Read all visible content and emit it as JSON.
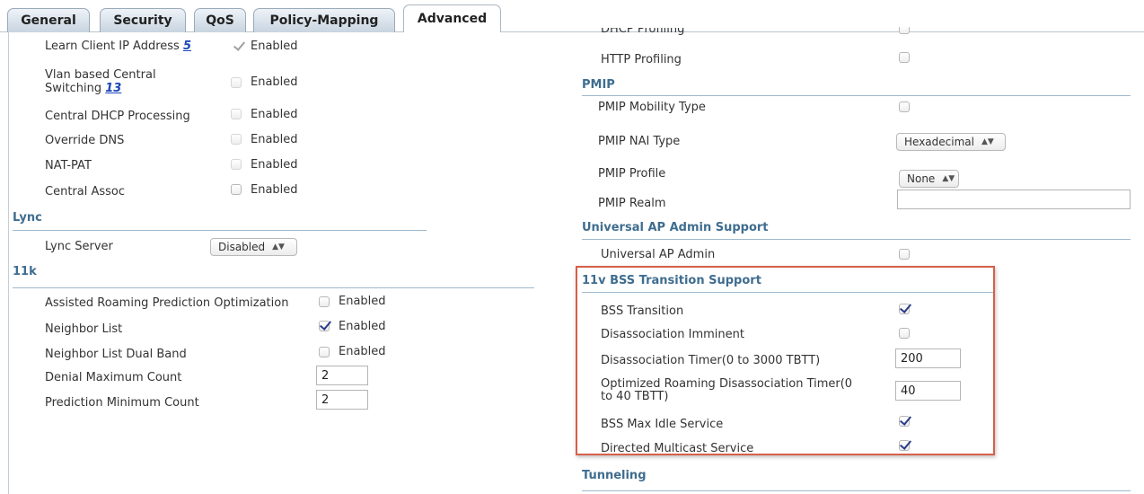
{
  "tabs": [
    "General",
    "Security",
    "QoS",
    "Policy-Mapping",
    "Advanced"
  ],
  "left": {
    "learn_client_ip": {
      "label": "Learn Client IP Address",
      "footnote": "5",
      "status": "Enabled"
    },
    "vlan_central": {
      "label1": "Vlan based Central",
      "label2": "Switching",
      "footnote": "13",
      "status": "Enabled"
    },
    "central_dhcp": {
      "label": "Central DHCP Processing",
      "status": "Enabled"
    },
    "override_dns": {
      "label": "Override DNS",
      "status": "Enabled"
    },
    "nat_pat": {
      "label": "NAT-PAT",
      "status": "Enabled"
    },
    "central_assoc": {
      "label": "Central Assoc",
      "status": "Enabled"
    },
    "lync_section": "Lync",
    "lync_server": {
      "label": "Lync Server",
      "value": "Disabled"
    },
    "k11_section": "11k",
    "arpo": {
      "label": "Assisted Roaming Prediction Optimization",
      "status": "Enabled"
    },
    "neighbor_list": {
      "label": "Neighbor List",
      "status": "Enabled"
    },
    "neighbor_dual": {
      "label": "Neighbor List Dual Band",
      "status": "Enabled"
    },
    "denial_max": {
      "label": "Denial Maximum Count",
      "value": "2"
    },
    "pred_min": {
      "label": "Prediction Minimum Count",
      "value": "2"
    }
  },
  "right": {
    "dhcp_profiling": "DHCP Profiling",
    "http_profiling": "HTTP Profiling",
    "pmip_section": "PMIP",
    "pmip_mobility": "PMIP Mobility Type",
    "pmip_nai": {
      "label": "PMIP NAI Type",
      "value": "Hexadecimal"
    },
    "pmip_profile": {
      "label": "PMIP Profile",
      "value": "None"
    },
    "pmip_realm": {
      "label": "PMIP Realm",
      "value": ""
    },
    "uap_section": "Universal AP Admin Support",
    "uap_admin": "Universal AP Admin",
    "bss_section": "11v BSS Transition Support",
    "bss_transition": "BSS Transition",
    "disassoc_imminent": "Disassociation Imminent",
    "disassoc_timer": {
      "label": "Disassociation Timer(0 to 3000 TBTT)",
      "value": "200"
    },
    "opt_roaming": {
      "label1": "Optimized Roaming Disassociation Timer(0",
      "label2": "to 40 TBTT)",
      "value": "40"
    },
    "bss_idle": "BSS Max Idle Service",
    "dms": "Directed Multicast Service",
    "tunneling_section": "Tunneling"
  }
}
